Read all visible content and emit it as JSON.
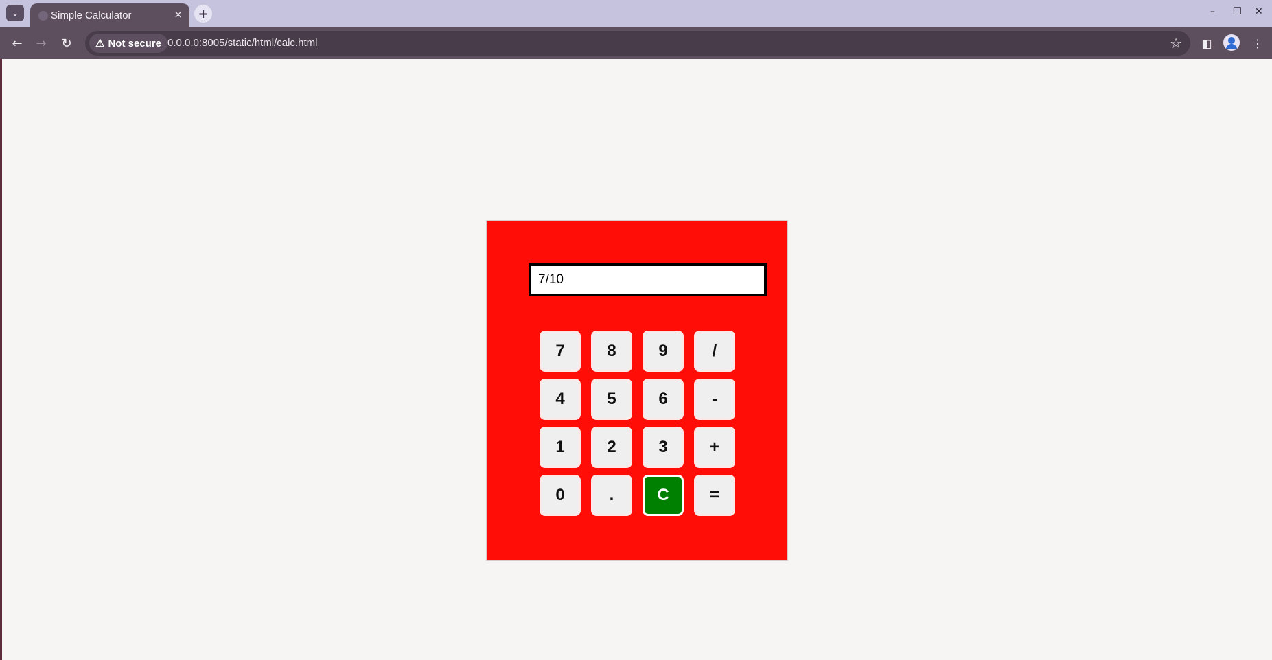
{
  "browser": {
    "tab_title": "Simple Calculator",
    "tab_close": "×",
    "new_tab": "+",
    "security_label": "Not secure",
    "url": "0.0.0.0:8005/static/html/calc.html"
  },
  "calculator": {
    "display_value": "7/10",
    "keys": [
      "7",
      "8",
      "9",
      "/",
      "4",
      "5",
      "6",
      "-",
      "1",
      "2",
      "3",
      "+",
      "0",
      ".",
      "C",
      "="
    ],
    "colors": {
      "background": "#ff0d06",
      "clear_key": "#008000",
      "key": "#efefef"
    }
  }
}
